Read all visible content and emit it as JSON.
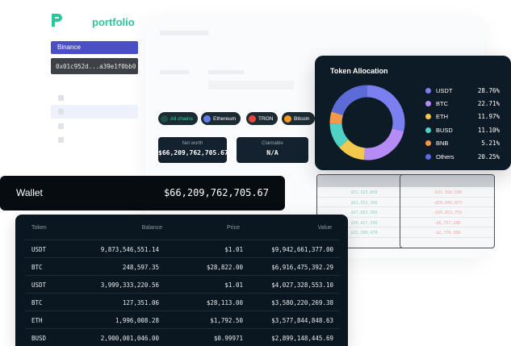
{
  "brand": {
    "name": "portfolio",
    "accent": "#2bc79a"
  },
  "sidebar": {
    "exchange": "Binance",
    "address": "0x01c952d...a39e1f0bb0"
  },
  "chains": [
    {
      "label": "All chains",
      "icon": "all-chains-icon",
      "color": "#2bd9a3",
      "active": true
    },
    {
      "label": "Ethereum",
      "icon": "ethereum-icon",
      "color": "#627eea",
      "active": false
    },
    {
      "label": "TRON",
      "icon": "tron-icon",
      "color": "#e5483b",
      "active": false
    },
    {
      "label": "Bitcoin",
      "icon": "bitcoin-icon",
      "color": "#f59a23",
      "active": false
    }
  ],
  "stats": {
    "net_worth_label": "Net worth",
    "net_worth_value": "$66,209,762,705.67",
    "claimable_label": "Claimable",
    "claimable_value": "N/A"
  },
  "allocation": {
    "title": "Token Allocation",
    "items": [
      {
        "name": "USDT",
        "percent": "28.76%",
        "share": 28.76,
        "color": "#7b7ff0"
      },
      {
        "name": "BTC",
        "percent": "22.71%",
        "share": 22.71,
        "color": "#b58cf5"
      },
      {
        "name": "ETH",
        "percent": "11.97%",
        "share": 11.97,
        "color": "#f2c94c"
      },
      {
        "name": "BUSD",
        "percent": "11.10%",
        "share": 11.1,
        "color": "#4fd1c5"
      },
      {
        "name": "BNB",
        "percent": "5.21%",
        "share": 5.21,
        "color": "#f2994a"
      },
      {
        "name": "Others",
        "percent": "20.25%",
        "share": 20.25,
        "color": "#5c6bd6"
      }
    ]
  },
  "wallet": {
    "title": "Wallet",
    "total": "$66,209,762,705.67"
  },
  "table": {
    "columns": {
      "token": "Token",
      "balance": "Balance",
      "price": "Price",
      "value": "Value"
    },
    "rows": [
      {
        "token": "USDT",
        "balance": "9,873,546,551.14",
        "price": "$1.01",
        "value": "$9,942,661,377.00"
      },
      {
        "token": "BTC",
        "balance": "248,597.35",
        "price": "$28,822.00",
        "value": "$6,916,475,392.29"
      },
      {
        "token": "USDT",
        "balance": "3,999,333,220.56",
        "price": "$1.01",
        "value": "$4,027,328,553.10"
      },
      {
        "token": "BTC",
        "balance": "127,351.06",
        "price": "$28,113.00",
        "value": "$3,580,220,269.38"
      },
      {
        "token": "ETH",
        "balance": "1,996,008.28",
        "price": "$1,792.50",
        "value": "$3,577,844,848.63"
      },
      {
        "token": "BUSD",
        "balance": "2,900,001,046.00",
        "price": "$0.99971",
        "value": "$2,899,148,445.69"
      }
    ]
  }
}
